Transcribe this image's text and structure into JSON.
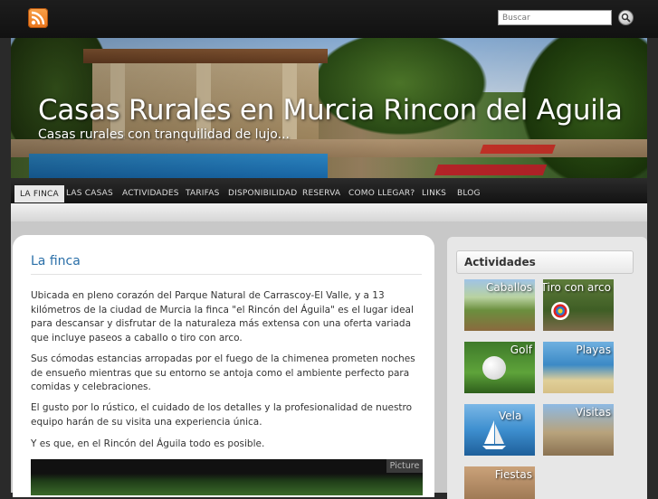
{
  "search": {
    "placeholder": "Buscar"
  },
  "header": {
    "title": "Casas Rurales en Murcia Rincon del Aguila",
    "tagline": "Casas rurales con tranquilidad de lujo..."
  },
  "nav": {
    "items": [
      {
        "label": "LA FINCA"
      },
      {
        "label": "LAS CASAS"
      },
      {
        "label": "ACTIVIDADES"
      },
      {
        "label": "TARIFAS"
      },
      {
        "label": "DISPONIBILIDAD"
      },
      {
        "label": "RESERVA"
      },
      {
        "label": "COMO LLEGAR?"
      },
      {
        "label": "LINKS"
      },
      {
        "label": "BLOG"
      }
    ],
    "active_index": 0
  },
  "content": {
    "title": "La finca",
    "paragraphs": [
      "Ubicada en pleno corazón del Parque Natural de Carrascoy-El Valle, y a 13 kilómetros de la ciudad de Murcia la finca \"el Rincón del Águila\" es el lugar ideal para descansar y disfrutar de la naturaleza más extensa con una oferta variada que incluye paseos a caballo o tiro con arco.",
      "Sus cómodas estancias arropadas por el fuego de la chimenea prometen noches de ensueño mientras que su entorno se antoja como el ambiente perfecto para comidas y celebraciones.",
      "El gusto por lo rústico, el cuidado de los detalles y la profesionalidad de nuestro equipo harán de su visita una experiencia única.",
      "Y es que, en el Rincón del Águila todo es posible."
    ],
    "photo_tab": "Picture"
  },
  "sidebar": {
    "title": "Actividades",
    "activities": [
      {
        "label": "Caballos"
      },
      {
        "label": "Tiro con arco"
      },
      {
        "label": "Golf"
      },
      {
        "label": "Playas"
      },
      {
        "label": "Vela"
      },
      {
        "label": "Visitas"
      },
      {
        "label": "Fiestas"
      }
    ]
  },
  "colors": {
    "accent": "#2a6fa8",
    "rss": "#e8741b",
    "navbar": "#1a1a1a",
    "active_tab": "#e8e8e8"
  }
}
